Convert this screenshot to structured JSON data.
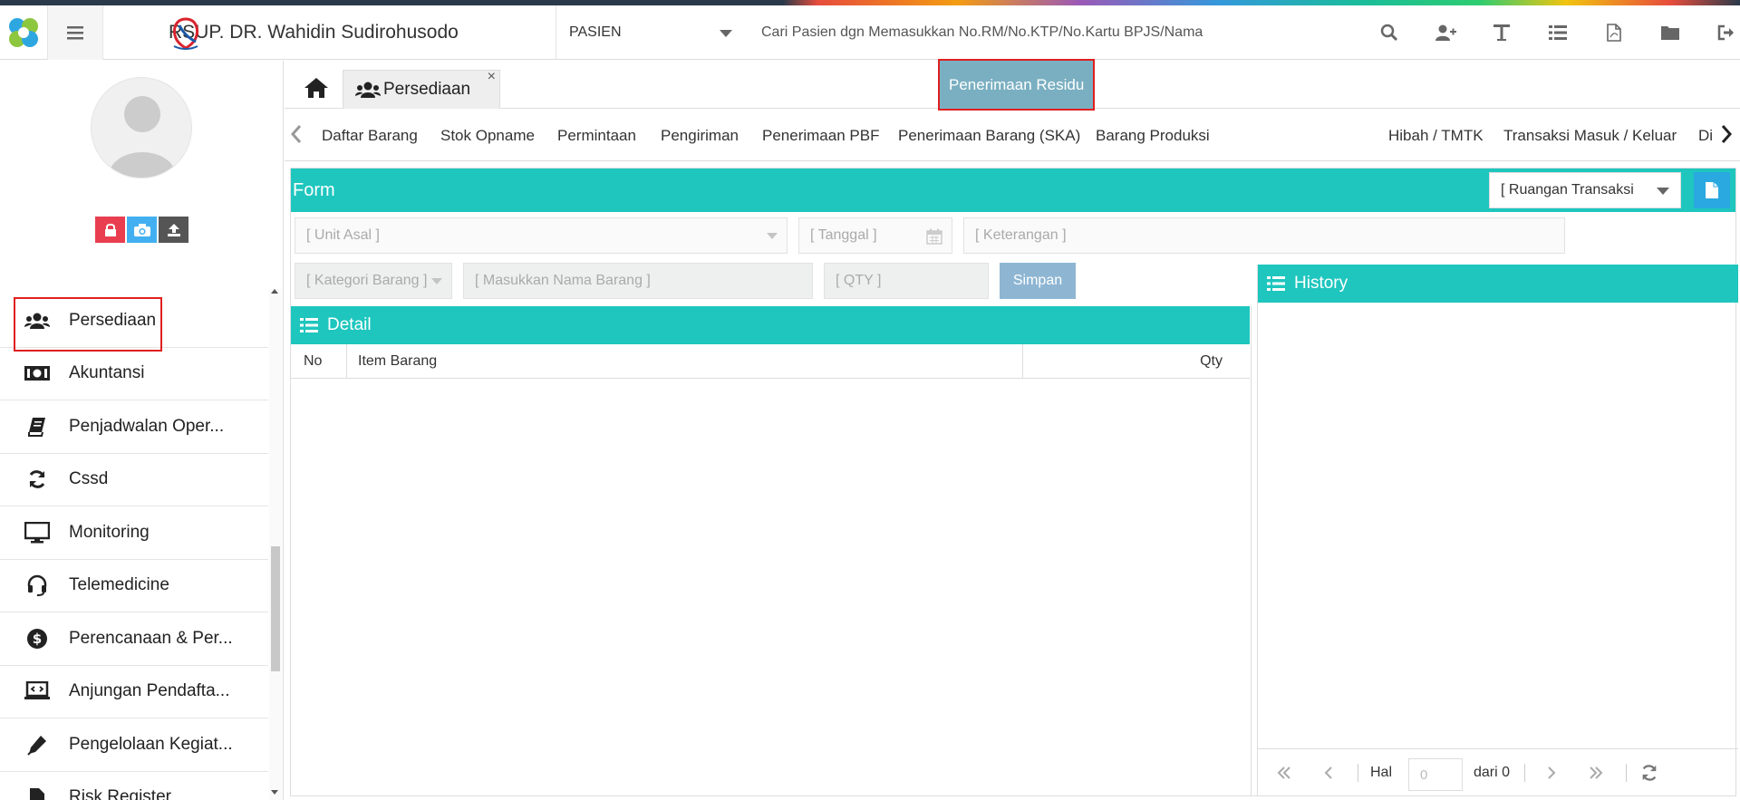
{
  "topbar": {
    "hospital_name": "RSUP. DR. Wahidin Sudirohusodo",
    "patient_select": "PASIEN",
    "search_placeholder": "Cari Pasien dgn Memasukkan No.RM/No.KTP/No.Kartu BPJS/Nama"
  },
  "colors": {
    "accent": "#1ec6be",
    "active_tab": "#7aafc1",
    "highlight": "#e02020",
    "primary_button": "#29a9e0",
    "simpan_button": "#8eb6d3"
  },
  "sidebar": {
    "items": [
      {
        "label": "Persediaan",
        "icon": "users-icon"
      },
      {
        "label": "Akuntansi",
        "icon": "money-icon"
      },
      {
        "label": "Penjadwalan Oper...",
        "icon": "book-icon"
      },
      {
        "label": "Cssd",
        "icon": "refresh-icon"
      },
      {
        "label": "Monitoring",
        "icon": "monitor-icon"
      },
      {
        "label": "Telemedicine",
        "icon": "headset-icon"
      },
      {
        "label": "Perencanaan & Per...",
        "icon": "dollar-icon"
      },
      {
        "label": "Anjungan Pendafta...",
        "icon": "laptop-code-icon"
      },
      {
        "label": "Pengelolaan Kegiat...",
        "icon": "pen-icon"
      },
      {
        "label": "Risk Register",
        "icon": "file-icon"
      }
    ]
  },
  "tabs": {
    "open_tab": "Persediaan",
    "close_symbol": "×"
  },
  "subtabs": [
    "Daftar Barang",
    "Stok Opname",
    "Permintaan",
    "Pengiriman",
    "Penerimaan PBF",
    "Penerimaan Barang (SKA)",
    "Barang Produksi",
    "Penerimaan Residu",
    "Hibah / TMTK",
    "Transaksi Masuk / Keluar",
    "Di"
  ],
  "active_subtab": "Penerimaan Residu",
  "form": {
    "title": "Form",
    "ruangan_select": "[ Ruangan Transaksi",
    "unit_asal_placeholder": "[ Unit Asal ]",
    "tanggal_placeholder": "[ Tanggal ]",
    "keterangan_placeholder": "[ Keterangan ]",
    "kategori_placeholder": "[ Kategori Barang ]",
    "nama_barang_placeholder": "[ Masukkan Nama Barang ]",
    "qty_placeholder": "[ QTY ]",
    "simpan_label": "Simpan"
  },
  "detail": {
    "title": "Detail",
    "columns": [
      "No",
      "Item Barang",
      "Qty"
    ],
    "rows": []
  },
  "history": {
    "title": "History",
    "pager": {
      "hal_label": "Hal",
      "page_value": "0",
      "dari_label": "dari 0"
    }
  }
}
